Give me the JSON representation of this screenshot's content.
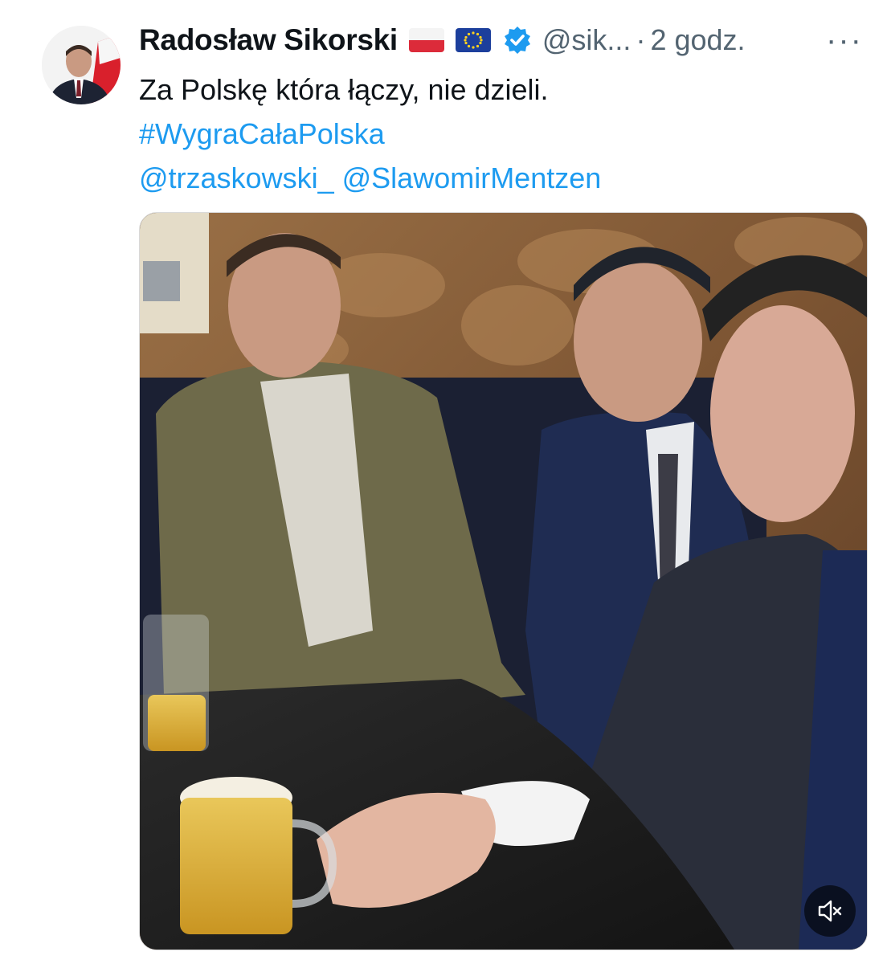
{
  "tweet": {
    "author_name": "Radosław Sikorski",
    "handle": "@sik...",
    "separator": "·",
    "time": "2 godz.",
    "more_label": "···",
    "text_line": "Za Polskę która łączy, nie dzieli.",
    "hashtag": "#WygraCałaPolska",
    "mention_1": "@trzaskowski_",
    "mention_2": "@SlawomirMentzen",
    "flags": [
      "poland-flag-icon",
      "eu-flag-icon"
    ],
    "verified_icon": "verified-badge-icon"
  },
  "media": {
    "type": "video",
    "mute_icon": "volume-muted-icon"
  },
  "colors": {
    "link": "#1d9bf0",
    "secondary_text": "#536471",
    "primary_text": "#0f1419"
  }
}
